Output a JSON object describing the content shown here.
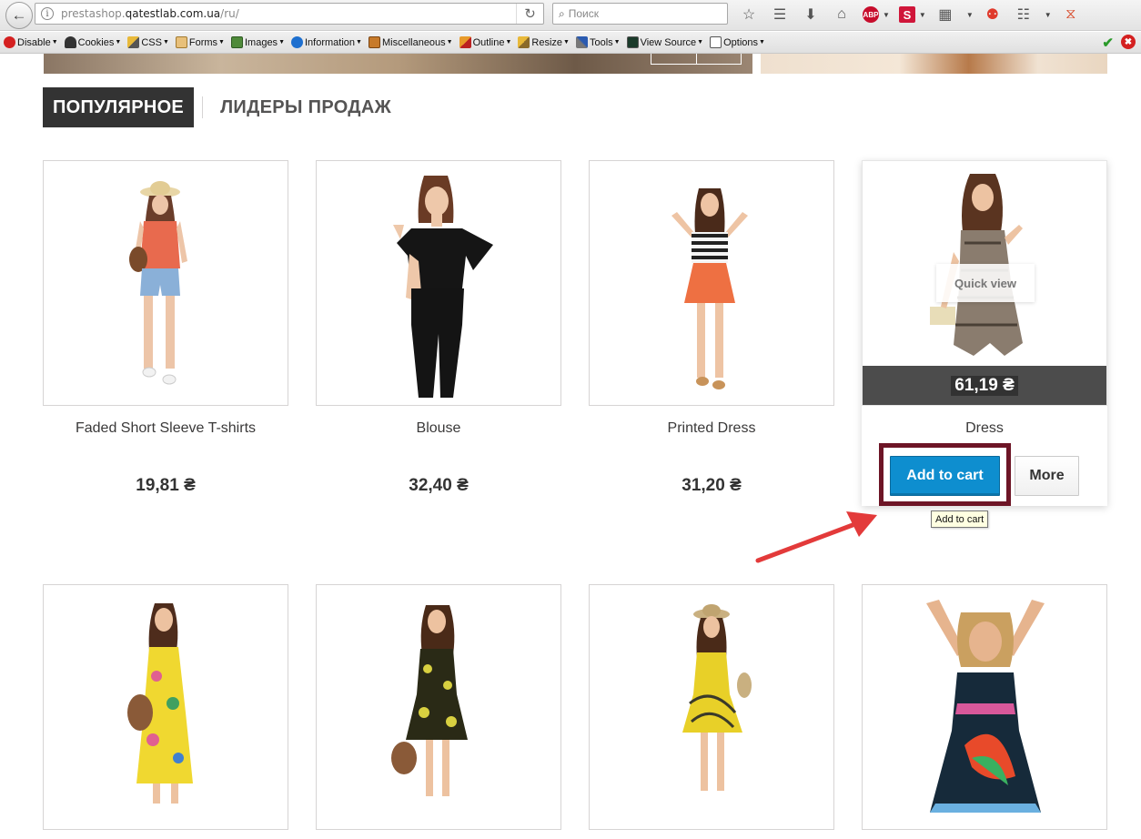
{
  "browser": {
    "url_prefix": "prestashop.",
    "url_domain": "qatestlab.com.ua",
    "url_path": "/ru/",
    "search_placeholder": "Поиск"
  },
  "devbar": {
    "items": [
      "Disable",
      "Cookies",
      "CSS",
      "Forms",
      "Images",
      "Information",
      "Miscellaneous",
      "Outline",
      "Resize",
      "Tools",
      "View Source",
      "Options"
    ]
  },
  "tabs": {
    "active": "ПОПУЛЯРНОЕ",
    "inactive": "ЛИДЕРЫ ПРОДАЖ"
  },
  "products": [
    {
      "name": "Faded Short Sleeve T-shirts",
      "price": "19,81 ₴"
    },
    {
      "name": "Blouse",
      "price": "32,40 ₴"
    },
    {
      "name": "Printed Dress",
      "price": "31,20 ₴"
    },
    {
      "name": "Dress",
      "price": "61,19 ₴",
      "quick_view": "Quick view",
      "add_to_cart": "Add to cart",
      "more": "More"
    }
  ],
  "tooltip": "Add to cart"
}
